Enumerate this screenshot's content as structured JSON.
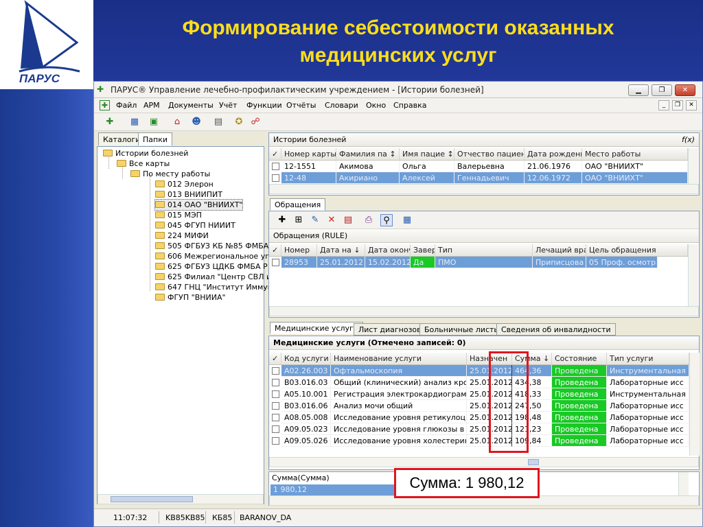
{
  "slide": {
    "title_line1": "Формирование себестоимости оказанных",
    "title_line2": "медицинских услуг",
    "logo_text": "ПАРУС",
    "header_color": "#1a2f86",
    "title_color": "#ffde1a"
  },
  "window": {
    "title": "ПАРУС® Управление лечебно-профилактическим учреждением - [Истории болезней]"
  },
  "menu": [
    "Файл",
    "АРМ",
    "Документы",
    "Учёт",
    "Функции",
    "Отчёты",
    "Словари",
    "Окно",
    "Справка"
  ],
  "left_tabs": [
    "Каталоги",
    "Папки"
  ],
  "tree": [
    {
      "label": "Истории болезней",
      "level": 0
    },
    {
      "label": "Все карты",
      "level": 1
    },
    {
      "label": "По месту работы",
      "level": 2
    },
    {
      "label": "012 Элерон",
      "level": 3
    },
    {
      "label": "013 ВНИИПИТ",
      "level": 3
    },
    {
      "label": "014 ОАО \"ВНИИХТ\"",
      "level": 3
    },
    {
      "label": "015 МЭП",
      "level": 3
    },
    {
      "label": "045 ФГУП НИИИТ",
      "level": 3
    },
    {
      "label": "224 МИФИ",
      "level": 3
    },
    {
      "label": "505 ФГБУЗ КБ №85 ФМБА",
      "level": 3
    },
    {
      "label": "606 Межрегиональное уп",
      "level": 3
    },
    {
      "label": "625 ФГБУЗ ЦДКБ ФМБА Р",
      "level": 3
    },
    {
      "label": "625 Филиал \"Центр СВЛ и",
      "level": 3
    },
    {
      "label": "647 ГНЦ \"Институт Иммун",
      "level": 3
    },
    {
      "label": "ФГУП \"ВНИИА\"",
      "level": 3
    }
  ],
  "histories": {
    "title": "Истории болезней",
    "fx": "f(x)",
    "columns": [
      "Номер карты",
      "Фамилия па",
      "Имя пацие",
      "Отчество пациен",
      "Дата рождени",
      "Место работы"
    ],
    "rows": [
      {
        "cells": [
          "12-1551",
          "Акимова",
          "Ольга",
          "Валерьевна",
          "21.06.1976",
          "ОАО \"ВНИИХТ\""
        ],
        "selected": false
      },
      {
        "cells": [
          "12-48",
          "Акириано",
          "Алексей",
          "Геннадьевич",
          "12.06.1972",
          "ОАО \"ВНИИХТ\""
        ],
        "selected": true
      }
    ]
  },
  "appeals_tab": "Обращения",
  "appeals": {
    "title": "Обращения (RULE)",
    "columns": [
      "Номер",
      "Дата на",
      "Дата оконч",
      "Завер",
      "Тип",
      "Лечащий вра",
      "Цель обращения"
    ],
    "rows": [
      {
        "cells": [
          "28953",
          "25.01.2012",
          "15.02.2012",
          "Да",
          "ПМО",
          "Приписцова",
          "05 Проф. осмотр"
        ]
      }
    ]
  },
  "service_tabs": [
    "Медицинские услуги",
    "Лист диагнозов",
    "Больничные листы",
    "Сведения об инвалидности"
  ],
  "services": {
    "title": "Медицинские услуги (Отмечено записей: 0)",
    "columns": [
      "Код услуги",
      "Наименование услуги",
      "Назначен",
      "Сумма",
      "Состояние",
      "Тип услуги"
    ],
    "rows": [
      {
        "cells": [
          "A02.26.003",
          "Офтальмоскопия",
          "25.01.2012",
          "464,36",
          "Проведена",
          "Инструментальная"
        ],
        "selected": true
      },
      {
        "cells": [
          "B03.016.03",
          "Общий (клинический) анализ крови",
          "25.01.2012",
          "434,38",
          "Проведена",
          "Лабораторные исс"
        ]
      },
      {
        "cells": [
          "A05.10.001",
          "Регистрация электрокардиограммы",
          "25.01.2012",
          "418,33",
          "Проведена",
          "Инструментальная"
        ]
      },
      {
        "cells": [
          "B03.016.06",
          "Анализ мочи общий",
          "25.01.2012",
          "247,50",
          "Проведена",
          "Лабораторные исс"
        ]
      },
      {
        "cells": [
          "A08.05.008",
          "Исследование уровня ретикулоцит",
          "25.01.2012",
          "198,48",
          "Проведена",
          "Лабораторные исс"
        ]
      },
      {
        "cells": [
          "A09.05.023",
          "Исследование уровня глюкозы в кр",
          "25.01.2012",
          "121,23",
          "Проведена",
          "Лабораторные исс"
        ]
      },
      {
        "cells": [
          "A09.05.026",
          "Исследование уровня холестерина",
          "25.01.2012",
          "109,84",
          "Проведена",
          "Лабораторные исс"
        ]
      }
    ]
  },
  "sum_panel": {
    "label": "Сумма(Сумма)",
    "value": "1 980,12"
  },
  "callout": "Сумма: 1 980,12",
  "status": {
    "time": "11:07:32",
    "db": "KB85KB85",
    "kb": "КБ85",
    "user": "BARANOV_DA"
  }
}
